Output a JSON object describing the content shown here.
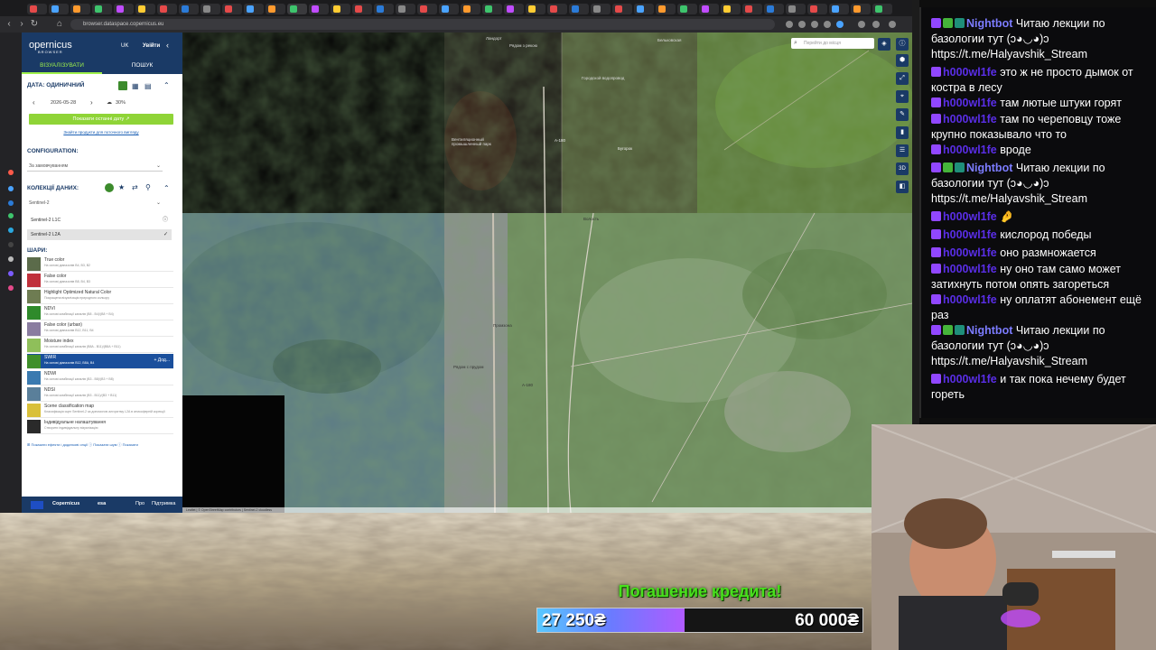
{
  "browser": {
    "url": "browser.dataspace.copernicus.eu"
  },
  "sidepanel": {
    "logo": "opernicus",
    "logo_sub": "BROWSER",
    "language": "UK",
    "login": "Увійти",
    "tabs": [
      "ВІЗУАЛІЗУВАТИ",
      "ПОШУК"
    ],
    "date_title": "ДАТА: ОДИНИЧНИЙ",
    "date_value": "2026-05-28",
    "cloud_value": "30%",
    "show_latest_button": "Показати останні дату ↗",
    "find_products_link": "Знайти продукти для поточного вигляду",
    "configuration_title": "CONFIGURATION:",
    "configuration_value": "За замовчуванням",
    "collections_title": "КОЛЕКЦІЇ ДАНИХ:",
    "collection_selected": "Sentinel-2",
    "collection_items": [
      "Sentinel-2 L1C",
      "Sentinel-2 L2A"
    ],
    "layers_title": "ШАРИ:",
    "layers": [
      {
        "name": "True color",
        "desc": "На основі діапазонів B4, B3, B2",
        "color": "#5b6b4a"
      },
      {
        "name": "False color",
        "desc": "На основі діапазонів B8, B4, B3",
        "color": "#c0303b"
      },
      {
        "name": "Highlight Optimized Natural Color",
        "desc": "Покращена візуалізація природного кольору",
        "color": "#6e7c52"
      },
      {
        "name": "NDVI",
        "desc": "На основі комбінації каналів (B8 - B4)/(B8 + B4)",
        "color": "#2f8a2b"
      },
      {
        "name": "False color (urban)",
        "desc": "На основі діапазонів B12, B11, B4",
        "color": "#8a7ca0"
      },
      {
        "name": "Moisture index",
        "desc": "На основі комбінації каналів (B8A - B11)/(B8A + B11)",
        "color": "#8fbf5a"
      },
      {
        "name": "SWIR",
        "desc": "На основі діапазонів B12, B8A, B4",
        "color": "#3f8f2a"
      },
      {
        "name": "NDWI",
        "desc": "На основі комбінації каналів (B3 - B8)/(B3 + B8)",
        "color": "#3a7ab0"
      },
      {
        "name": "NDSI",
        "desc": "На основі комбінації каналів (B3 - B11)/(B3 + B11)",
        "color": "#5a7f9a"
      },
      {
        "name": "Scene classification map",
        "desc": "Класифікація сцен Sentinel-2 за допомогою алгоритму L2A в атмосферній корекції",
        "color": "#d9c03a"
      },
      {
        "name": "Індивідуальне налаштування",
        "desc": "Створити індивідуальну візуалізацію",
        "color": "#2a2a2a"
      }
    ],
    "active_layer_add": "+ Дод...",
    "footer_links": "⊞ Показати ефекти і додаткові опції   ⓘ Показати шум   ⓘ Показати",
    "bottom_about": "Про",
    "bottom_support": "Підтримка",
    "bottom_esa": "esa",
    "bottom_copernicus": "Copernicus"
  },
  "map": {
    "search_placeholder": "Перейти до місця",
    "labels": [
      "Ландорт",
      "Рядом з рекою",
      "Бельковская",
      "Городской водопровод",
      "A-180",
      "Бугорок",
      "Промзона",
      "Рядом с прудом",
      "A-180",
      "Вентиляционный промышленный парк",
      "Волость"
    ],
    "credit": "Leaflet | © OpenStreetMap contributors | Sentinel-2 cloudless"
  },
  "chat": {
    "messages": [
      {
        "user": "Nightbot",
        "kind": "nightbot",
        "text": "Читаю лекции по базологии тут (ↄ◕◡◕)ↄ https://t.me/Halyavshik_Stream"
      },
      {
        "user": "h000wl1fe",
        "kind": "hobo",
        "text": "это ж не просто дымок от костра в лесу"
      },
      {
        "user": "h000wl1fe",
        "kind": "hobo",
        "text": "там лютые штуки горят"
      },
      {
        "user": "h000wl1fe",
        "kind": "hobo",
        "text": "там по череповцу тоже крупно показывало что то"
      },
      {
        "user": "h000wl1fe",
        "kind": "hobo",
        "text": "вроде"
      },
      {
        "user": "Nightbot",
        "kind": "nightbot",
        "text": "Читаю лекции по базологии тут (ↄ◕◡◕)ↄ https://t.me/Halyavshik_Stream"
      },
      {
        "user": "h000wl1fe",
        "kind": "hobo",
        "text": "🤌"
      },
      {
        "user": "h000wl1fe",
        "kind": "hobo",
        "text": "кислород победы"
      },
      {
        "user": "h000wl1fe",
        "kind": "hobo",
        "text": "оно размножается"
      },
      {
        "user": "h000wl1fe",
        "kind": "hobo",
        "text": "ну оно там само может затихнуть потом опять загореться"
      },
      {
        "user": "h000wl1fe",
        "kind": "hobo",
        "text": "ну оплатят абонемент ещё раз"
      },
      {
        "user": "Nightbot",
        "kind": "nightbot",
        "text": "Читаю лекции по базологии тут (ↄ◕◡◕)ↄ https://t.me/Halyavshik_Stream"
      },
      {
        "user": "h000wl1fe",
        "kind": "hobo",
        "text": "и так пока нечему будет гореть"
      }
    ]
  },
  "donation": {
    "title": "Погашение кредита!",
    "current": "27 250₴",
    "target": "60 000₴",
    "progress": 0.454
  }
}
